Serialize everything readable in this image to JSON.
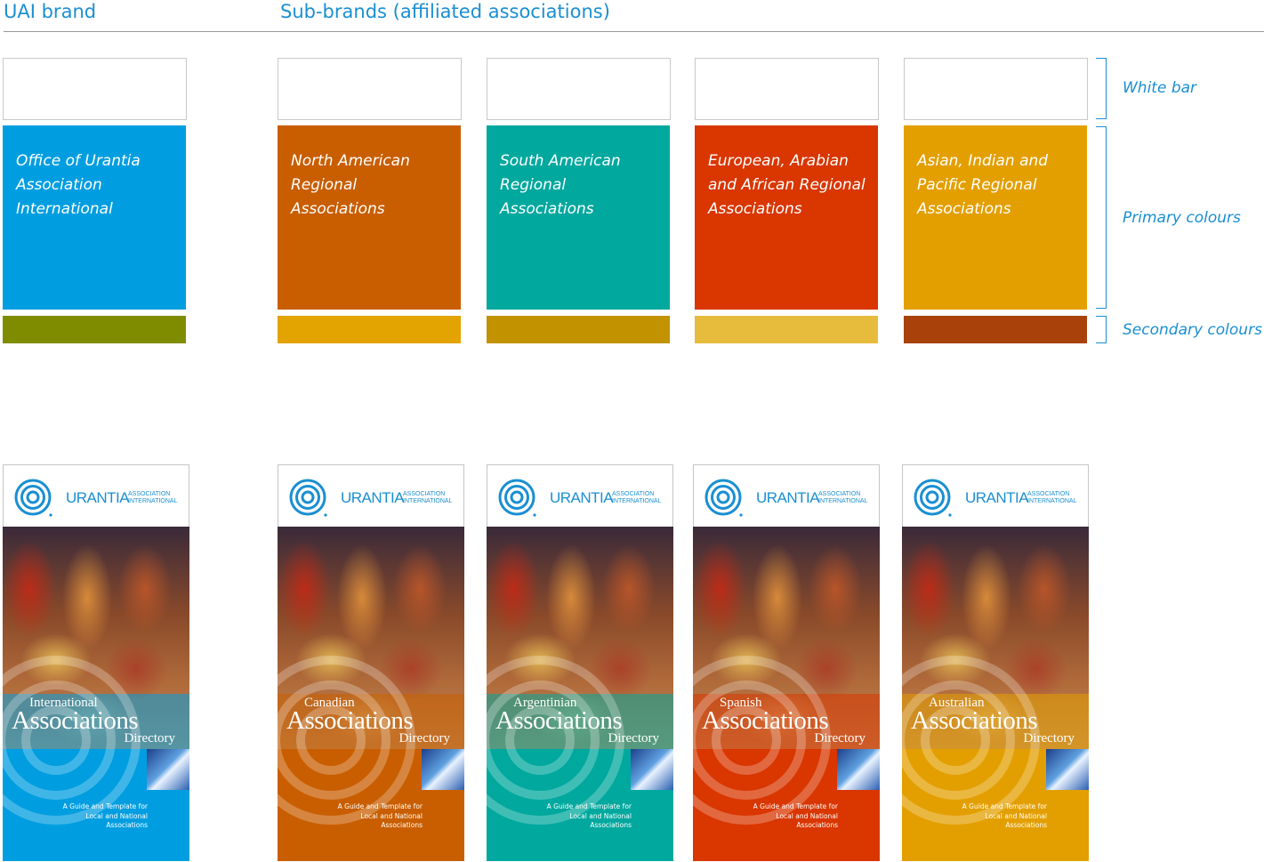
{
  "headers": {
    "uai_brand": "UAI brand",
    "sub_brands": "Sub-brands (affiliated associations)"
  },
  "side_labels": {
    "white_bar": "White bar",
    "primary": "Primary colours",
    "secondary": "Secondary colours"
  },
  "swatches": [
    {
      "label": "Office of Urantia Association International",
      "primary": "#009ee0",
      "secondary": "#7f8c00"
    },
    {
      "label": "North American Regional Associations",
      "primary": "#c95e00",
      "secondary": "#e3a300"
    },
    {
      "label": "South American Regional Associations",
      "primary": "#00a89e",
      "secondary": "#c29200"
    },
    {
      "label": "European, Arabian and African Regional Associations",
      "primary": "#d93600",
      "secondary": "#e7bc3d"
    },
    {
      "label": "Asian, Indian and Pacific Regional Associations",
      "primary": "#e39f00",
      "secondary": "#a8420a"
    }
  ],
  "cards": [
    {
      "region": "International",
      "title": "Associations",
      "subtitle": "Directory",
      "color": "#009ee0"
    },
    {
      "region": "Canadian",
      "title": "Associations",
      "subtitle": "Directory",
      "color": "#c95e00"
    },
    {
      "region": "Argentinian",
      "title": "Associations",
      "subtitle": "Directory",
      "color": "#00a89e"
    },
    {
      "region": "Spanish",
      "title": "Associations",
      "subtitle": "Directory",
      "color": "#d93600"
    },
    {
      "region": "Australian",
      "title": "Associations",
      "subtitle": "Directory",
      "color": "#e39f00"
    }
  ],
  "card_common": {
    "wordmark": "URANTIA",
    "assoc_line1": "ASSOCIATION",
    "assoc_line2": "INTERNATIONAL",
    "guide_text": "A Guide and Template for Local and National Associations"
  },
  "accent_color": "#1a8fd2"
}
